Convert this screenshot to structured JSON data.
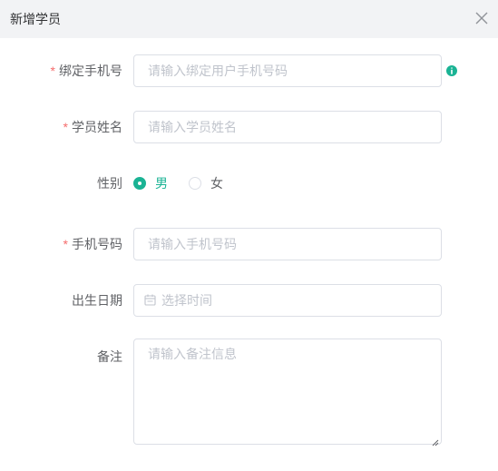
{
  "dialog": {
    "title": "新增学员",
    "close_icon": "close-icon"
  },
  "form": {
    "bind_phone": {
      "label": "绑定手机号",
      "required": true,
      "placeholder": "请输入绑定用户手机号码",
      "value": "",
      "info_icon": "info-icon",
      "info_color": "#1ab394"
    },
    "student_name": {
      "label": "学员姓名",
      "required": true,
      "placeholder": "请输入学员姓名",
      "value": ""
    },
    "gender": {
      "label": "性别",
      "options": [
        "男",
        "女"
      ],
      "selected": "男",
      "accent_color": "#1ab394"
    },
    "phone": {
      "label": "手机号码",
      "required": true,
      "placeholder": "请输入手机号码",
      "value": ""
    },
    "birth_date": {
      "label": "出生日期",
      "placeholder": "选择时间",
      "value": "",
      "icon": "calendar-icon"
    },
    "remark": {
      "label": "备注",
      "placeholder": "请输入备注信息",
      "value": ""
    }
  },
  "colors": {
    "required_star": "#f56c6c",
    "header_bg": "#f2f3f5",
    "border": "#dcdfe6",
    "placeholder": "#c0c4cc"
  }
}
